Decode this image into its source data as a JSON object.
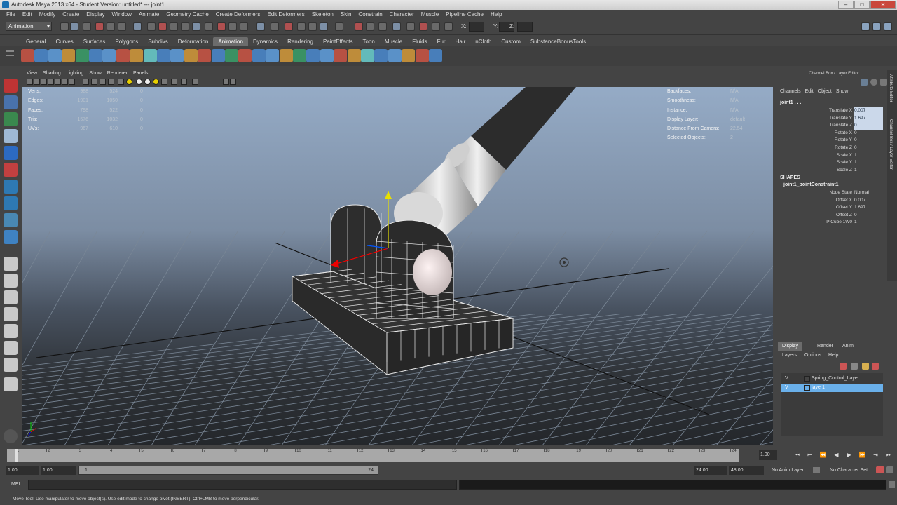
{
  "window": {
    "title": "Autodesk Maya 2013 x64 - Student Version: untitled*  ---  joint1..."
  },
  "menubar": [
    "File",
    "Edit",
    "Modify",
    "Create",
    "Display",
    "Window",
    "Animate",
    "Geometry Cache",
    "Create Deformers",
    "Edit Deformers",
    "Skeleton",
    "Skin",
    "Constrain",
    "Character",
    "Muscle",
    "Pipeline Cache",
    "Help"
  ],
  "statusline": {
    "mode": "Animation",
    "x_label": "X:",
    "y_label": "Y:",
    "z_label": "Z:"
  },
  "shelf_tabs": [
    "General",
    "Curves",
    "Surfaces",
    "Polygons",
    "Subdivs",
    "Deformation",
    "Animation",
    "Dynamics",
    "Rendering",
    "PaintEffects",
    "Toon",
    "Muscle",
    "Fluids",
    "Fur",
    "Hair",
    "nCloth",
    "Custom",
    "SubstanceBonusTools"
  ],
  "shelf_active": "Animation",
  "panel_menu": [
    "View",
    "Shading",
    "Lighting",
    "Show",
    "Renderer",
    "Panels"
  ],
  "hud_left": [
    {
      "k": "Verts:",
      "v1": "988",
      "v2": "524",
      "v3": "0"
    },
    {
      "k": "Edges:",
      "v1": "1901",
      "v2": "1050",
      "v3": "0"
    },
    {
      "k": "Faces:",
      "v1": "798",
      "v2": "522",
      "v3": "0"
    },
    {
      "k": "Tris:",
      "v1": "1576",
      "v2": "1032",
      "v3": "0"
    },
    {
      "k": "UVs:",
      "v1": "967",
      "v2": "610",
      "v3": "0"
    }
  ],
  "hud_right": [
    {
      "k": "Backfaces:",
      "v": "N/A"
    },
    {
      "k": "Smoothness:",
      "v": "N/A"
    },
    {
      "k": "Instance:",
      "v": "N/A"
    },
    {
      "k": "Display Layer:",
      "v": "default"
    },
    {
      "k": "Distance From Camera:",
      "v": "22.54"
    },
    {
      "k": "Selected Objects:",
      "v": "2"
    }
  ],
  "channel_box": {
    "title": "Channel Box / Layer Editor",
    "menu": [
      "Channels",
      "Edit",
      "Object",
      "Show"
    ],
    "object": "joint1 . . .",
    "attrs": [
      {
        "name": "Translate X",
        "value": "0.007",
        "highlight": true
      },
      {
        "name": "Translate Y",
        "value": "1.697",
        "highlight": true
      },
      {
        "name": "Translate Z",
        "value": "0",
        "highlight": true
      },
      {
        "name": "Rotate X",
        "value": "0",
        "highlight": false
      },
      {
        "name": "Rotate Y",
        "value": "0",
        "highlight": false
      },
      {
        "name": "Rotate Z",
        "value": "0",
        "highlight": false
      },
      {
        "name": "Scale X",
        "value": "1",
        "highlight": false
      },
      {
        "name": "Scale Y",
        "value": "1",
        "highlight": false
      },
      {
        "name": "Scale Z",
        "value": "1",
        "highlight": false
      }
    ],
    "shapes_label": "SHAPES",
    "shape_name": "joint1_pointConstraint1",
    "shape_attrs": [
      {
        "name": "Node State",
        "value": "Normal"
      },
      {
        "name": "Offset X",
        "value": "0.007"
      },
      {
        "name": "Offset Y",
        "value": "1.697"
      },
      {
        "name": "Offset Z",
        "value": "0"
      },
      {
        "name": "P Cube 1W0",
        "value": "1"
      }
    ]
  },
  "side_tabs": [
    "Attribute Editor",
    "Channel Box / Layer Editor"
  ],
  "layer_editor": {
    "tabs": [
      "Display",
      "Render",
      "Anim"
    ],
    "active_tab": "Display",
    "menu": [
      "Layers",
      "Options",
      "Help"
    ],
    "layers": [
      {
        "vis": "V",
        "name": "Spring_Control_Layer",
        "selected": false
      },
      {
        "vis": "V",
        "name": "layer1",
        "selected": true
      }
    ]
  },
  "timeline": {
    "ticks": [
      "1",
      "2",
      "3",
      "4",
      "5",
      "6",
      "7",
      "8",
      "9",
      "10",
      "11",
      "12",
      "13",
      "14",
      "15",
      "16",
      "17",
      "18",
      "19",
      "20",
      "21",
      "22",
      "23",
      "24"
    ],
    "current_frame": "1.00"
  },
  "range": {
    "start": "1.00",
    "playback_start": "1.00",
    "slider_start": "1",
    "slider_end": "24",
    "playback_end": "24.00",
    "end": "48.00",
    "anim_layer": "No Anim Layer",
    "char_set": "No Character Set"
  },
  "cmdline": {
    "label": "MEL"
  },
  "helpline": "Move Tool: Use manipulator to move object(s). Use edit mode to change pivot (INSERT). Ctrl+LMB to move perpendicular.",
  "colors": {
    "accent": "#6ab0ea",
    "panel": "#444444",
    "viewport_top": "#95abc6"
  }
}
